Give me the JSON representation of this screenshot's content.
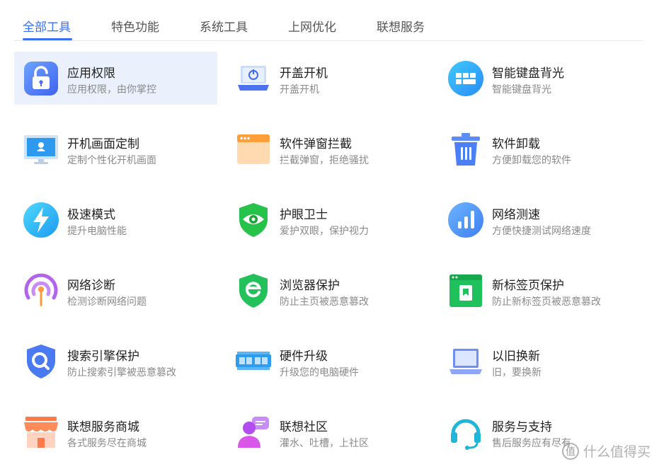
{
  "tabs": [
    {
      "label": "全部工具",
      "active": true
    },
    {
      "label": "特色功能",
      "active": false
    },
    {
      "label": "系统工具",
      "active": false
    },
    {
      "label": "上网优化",
      "active": false
    },
    {
      "label": "联想服务",
      "active": false
    }
  ],
  "tools": [
    {
      "title": "应用权限",
      "desc": "应用权限，由你掌控",
      "icon": "lock-icon",
      "selected": true
    },
    {
      "title": "开盖开机",
      "desc": "开盖开机",
      "icon": "laptop-power-icon"
    },
    {
      "title": "智能键盘背光",
      "desc": "智能键盘背光",
      "icon": "keyboard-backlight-icon"
    },
    {
      "title": "开机画面定制",
      "desc": "定制个性化开机画面",
      "icon": "monitor-icon"
    },
    {
      "title": "软件弹窗拦截",
      "desc": "拦截弹窗，拒绝骚扰",
      "icon": "popup-window-icon"
    },
    {
      "title": "软件卸载",
      "desc": "方便卸载您的软件",
      "icon": "trash-icon"
    },
    {
      "title": "极速模式",
      "desc": "提升电脑性能",
      "icon": "lightning-icon"
    },
    {
      "title": "护眼卫士",
      "desc": "爱护双眼，保护视力",
      "icon": "eye-shield-icon"
    },
    {
      "title": "网络测速",
      "desc": "方便快捷测试网络速度",
      "icon": "bar-chart-icon"
    },
    {
      "title": "网络诊断",
      "desc": "检测诊断网络问题",
      "icon": "signal-icon"
    },
    {
      "title": "浏览器保护",
      "desc": "防止主页被恶意篡改",
      "icon": "browser-shield-icon"
    },
    {
      "title": "新标签页保护",
      "desc": "防止新标签页被恶意篡改",
      "icon": "tab-bookmark-icon"
    },
    {
      "title": "搜索引擎保护",
      "desc": "防止搜索引擎被恶意篡改",
      "icon": "search-shield-icon"
    },
    {
      "title": "硬件升级",
      "desc": "升级您的电脑硬件",
      "icon": "memory-chip-icon"
    },
    {
      "title": "以旧换新",
      "desc": "旧，要换新",
      "icon": "laptop-icon"
    },
    {
      "title": "联想服务商城",
      "desc": "各式服务尽在商城",
      "icon": "store-icon"
    },
    {
      "title": "联想社区",
      "desc": "灌水、吐槽，上社区",
      "icon": "community-icon"
    },
    {
      "title": "服务与支持",
      "desc": "售后服务应有尽有",
      "icon": "headset-icon"
    }
  ],
  "watermark": {
    "text": "什么值得买",
    "badge": "值"
  },
  "colors": {
    "accent": "#3b6ef5",
    "selected_bg": "#eaf1fd",
    "text": "#222222",
    "muted": "#8a8a8a"
  }
}
